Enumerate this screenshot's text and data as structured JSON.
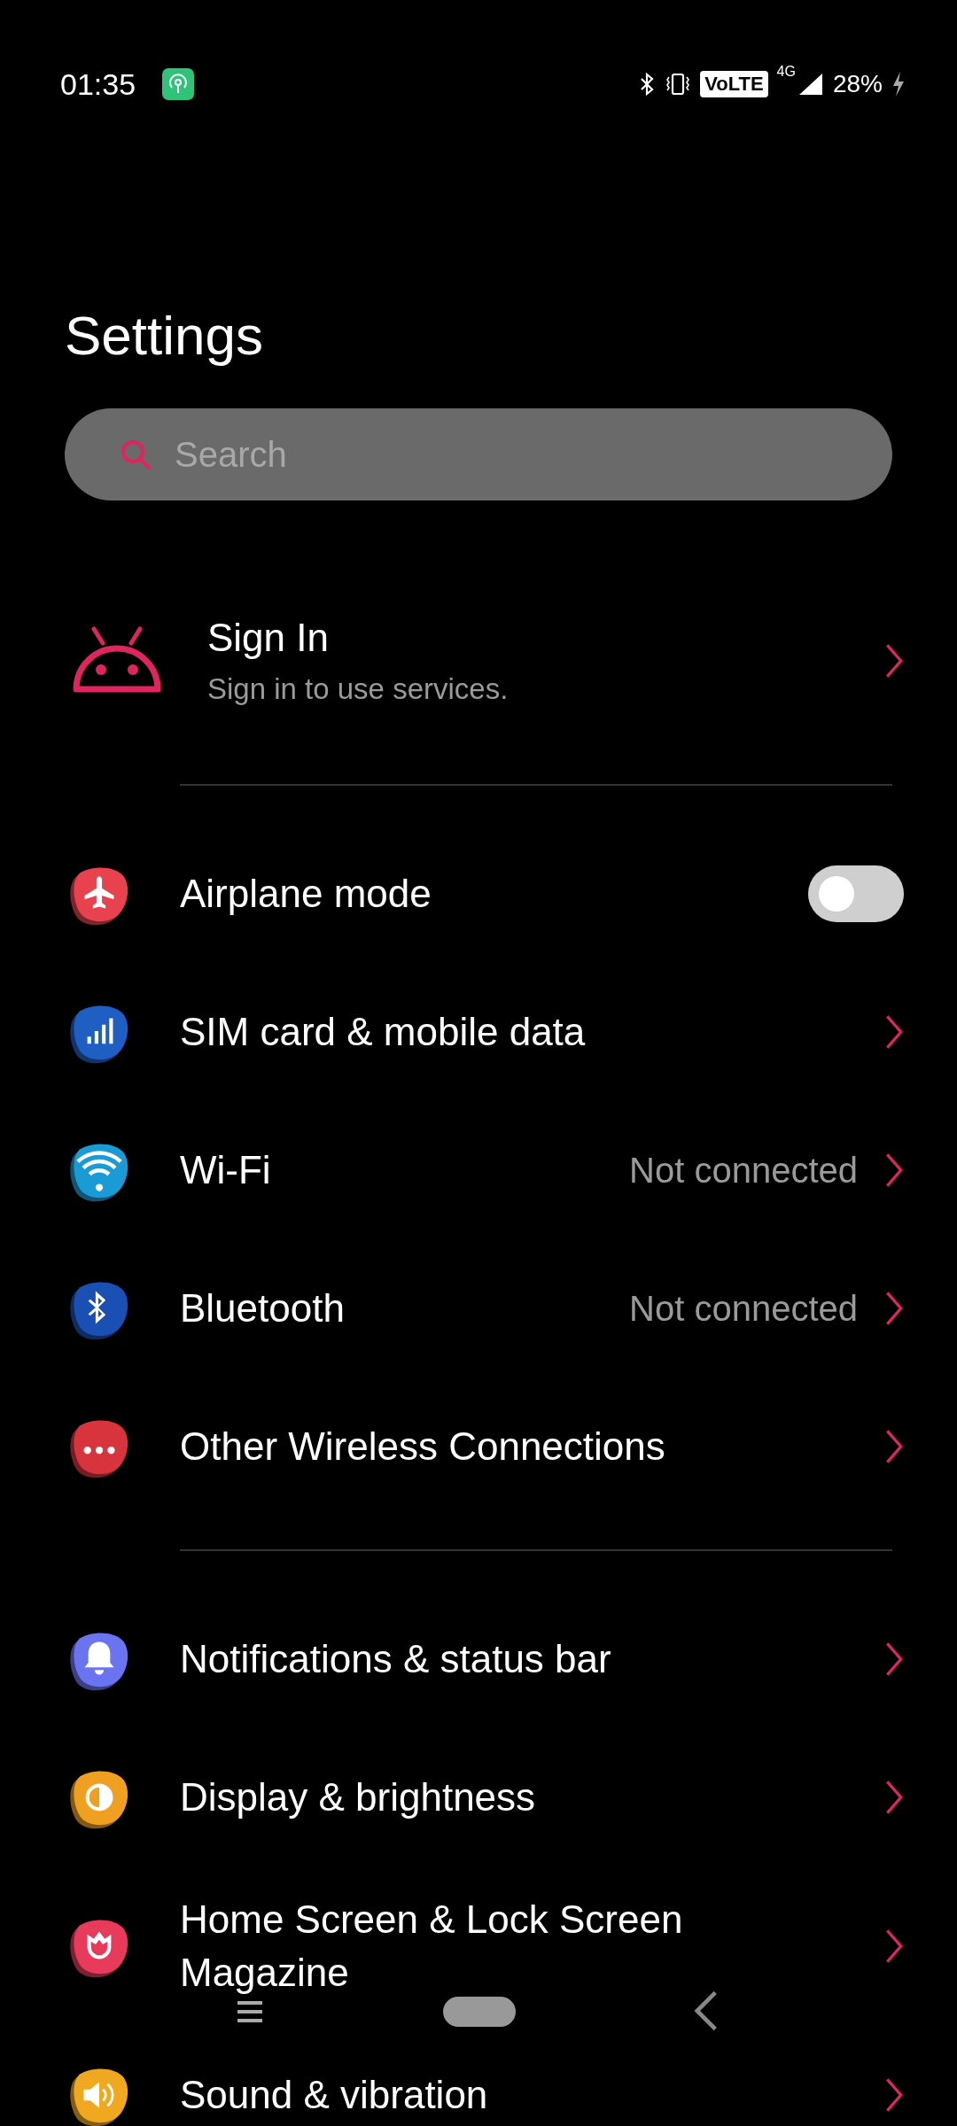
{
  "status_bar": {
    "time": "01:35",
    "volte": "VoLTE",
    "network": "4G",
    "battery": "28%"
  },
  "title": "Settings",
  "search": {
    "placeholder": "Search"
  },
  "account": {
    "title": "Sign In",
    "subtitle": "Sign in to use services."
  },
  "sections": [
    {
      "items": [
        {
          "kind": "toggle",
          "label": "Airplane mode",
          "on": false,
          "color": "#e8424f"
        },
        {
          "kind": "link",
          "label": "SIM card & mobile data",
          "color": "#1f5fc4"
        },
        {
          "kind": "link",
          "label": "Wi-Fi",
          "value": "Not connected",
          "color": "#1b9bd6"
        },
        {
          "kind": "link",
          "label": "Bluetooth",
          "value": "Not connected",
          "color": "#1a4fb3"
        },
        {
          "kind": "link",
          "label": "Other Wireless Connections",
          "color": "#d8343e"
        }
      ]
    },
    {
      "items": [
        {
          "kind": "link",
          "label": "Notifications & status bar",
          "color": "#6b74f0"
        },
        {
          "kind": "link",
          "label": "Display & brightness",
          "color": "#f0a020"
        },
        {
          "kind": "link",
          "label": "Home Screen & Lock Screen Magazine",
          "color": "#e83a5a"
        },
        {
          "kind": "link",
          "label": "Sound & vibration",
          "color": "#f0a820"
        }
      ]
    }
  ]
}
